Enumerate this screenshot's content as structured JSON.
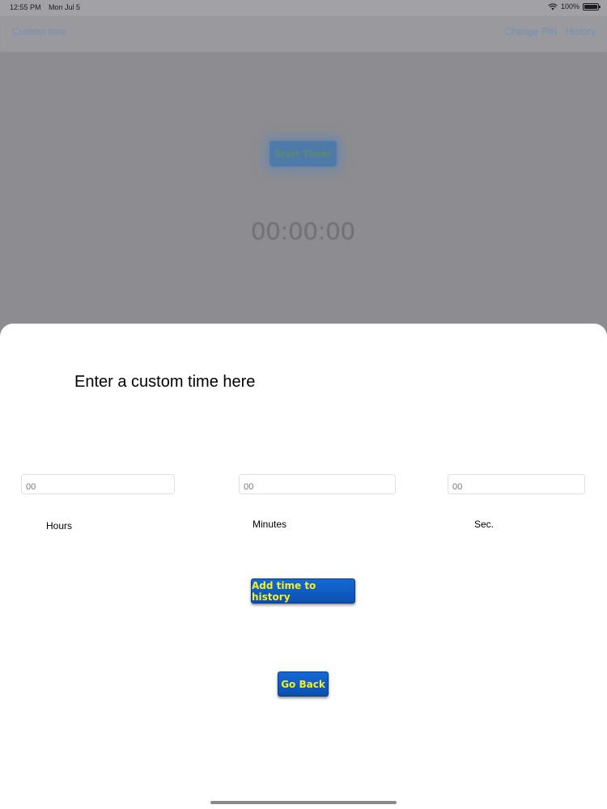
{
  "status_bar": {
    "time": "12:55 PM",
    "date": "Mon Jul 5",
    "battery": "100%"
  },
  "nav": {
    "left_label": "Custom time",
    "right_items": [
      "Change PIN",
      "History"
    ]
  },
  "background": {
    "start_button_label": "Start Timer",
    "clock": "00:00:00"
  },
  "sheet": {
    "title": "Enter a custom time here",
    "hours": {
      "placeholder": "00",
      "label": "Hours"
    },
    "minutes": {
      "placeholder": "00",
      "label": "Minutes"
    },
    "seconds": {
      "placeholder": "00",
      "label": "Sec."
    },
    "add_button_label": "Add time to history",
    "back_button_label": "Go Back"
  },
  "colors": {
    "button_blue": "#0f5fc4",
    "button_text": "#f4f022",
    "dim_overlay": "#8d8d91"
  }
}
